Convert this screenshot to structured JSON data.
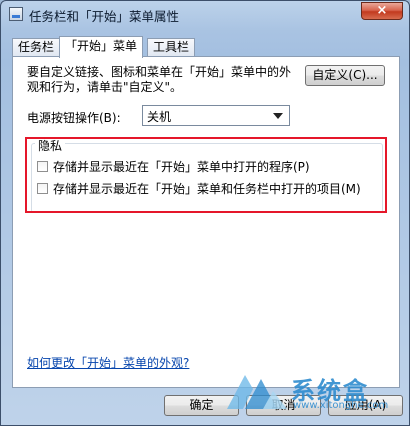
{
  "window": {
    "title": "任务栏和「开始」菜单属性",
    "close_symbol": "×"
  },
  "tabs": [
    {
      "label": "任务栏",
      "active": false
    },
    {
      "label": "「开始」菜单",
      "active": true
    },
    {
      "label": "工具栏",
      "active": false
    }
  ],
  "start_menu": {
    "description": "要自定义链接、图标和菜单在「开始」菜单中的外观和行为，请单击\"自定义\"。",
    "customize_button": "自定义(C)...",
    "power_button_label": "电源按钮操作(B):",
    "power_button_value": "关机"
  },
  "privacy": {
    "title": "隐私",
    "options": [
      {
        "label": "存储并显示最近在「开始」菜单中打开的程序(P)",
        "checked": false
      },
      {
        "label": "存储并显示最近在「开始」菜单和任务栏中打开的项目(M)",
        "checked": false
      }
    ],
    "highlight_color": "#e5172a"
  },
  "help_link": "如何更改「开始」菜单的外观?",
  "buttons": {
    "ok": "确定",
    "cancel": "取消",
    "apply": "应用(A)"
  },
  "watermark": {
    "brand": "系统盒",
    "url": "www.xitonghe.com"
  },
  "colors": {
    "link": "#0645ad",
    "window_frame": "#a9c3e2",
    "close_button": "#c23a1f"
  }
}
